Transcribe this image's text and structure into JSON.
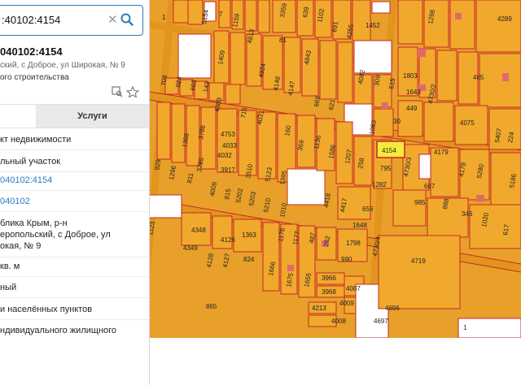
{
  "search": {
    "value": ":40102:4154"
  },
  "card": {
    "title": "040102:4154",
    "address": "ский, с Доброе, ул Широкая, № 9",
    "type": "ого строительства"
  },
  "tabs": {
    "services_label": "Услуги"
  },
  "details": [
    "кт недвижимости",
    "льный участок",
    "040102:4154",
    "040102",
    "блика Крым, р-н",
    "еропольский, с Доброе, ул",
    "окая, № 9",
    "кв. м",
    "ный",
    "и населённых пунктов",
    "ндивидуального жилищного"
  ],
  "map_labels": {
    "l1": "1",
    "l2": "5154",
    "l3": "7",
    "l4": "1159",
    "l5": "4813",
    "l6": "3359",
    "l7": "639",
    "l8": "1102",
    "l9": "691",
    "l10": "4255",
    "l11": "1452",
    "l12": "1298",
    "l13": "4289",
    "l14": "81",
    "l15": "4843",
    "l16": "4082",
    "l17": "309",
    "l18": "515",
    "l19": "1803",
    "l20": "1643",
    "l21": "465",
    "l22": "708",
    "l23": "924",
    "l24": "663",
    "l25": "143",
    "l26": "1409",
    "l27": "4803",
    "l28": "4924",
    "l29": "4148",
    "l30": "4147",
    "l31": "669",
    "l32": "621",
    "l33": "449",
    "l34": "4730/2",
    "l35": "4075",
    "l36": "715",
    "l37": "4031",
    "l38": "1308",
    "l39": "3786",
    "l40": "4753",
    "l41": "4033",
    "l42": "369",
    "l43": "1136",
    "l44": "160",
    "l45": "1083",
    "l46": "30",
    "l47": "4154",
    "l48": "4179",
    "l49": "5407",
    "l50": "224",
    "l51": "1296",
    "l52": "3785",
    "l53": "4032",
    "l54": "3917",
    "l55": "3510",
    "l56": "5123",
    "l57": "1385",
    "l58": "1586",
    "l59": "1207",
    "l60": "258",
    "l61": "795",
    "l62": "4730/3",
    "l63": "4178",
    "l64": "5280",
    "l65": "811",
    "l66": "929",
    "l67": "4009",
    "l68": "815",
    "l69": "5202",
    "l70": "5203",
    "l71": "1282",
    "l72": "667",
    "l73": "985",
    "l74": "888",
    "l75": "346",
    "l76": "5186",
    "l77": "1123",
    "l78": "5210",
    "l79": "1010",
    "l80": "4418",
    "l81": "4417",
    "l82": "656",
    "l83": "1020",
    "l84": "617",
    "l85": "4348",
    "l86": "4126",
    "l87": "1363",
    "l88": "1176",
    "l89": "1177",
    "l90": "1648",
    "l91": "4349",
    "l92": "4128",
    "l93": "4127",
    "l94": "824",
    "l95": "487",
    "l96": "262",
    "l97": "1798",
    "l98": "4730/4",
    "l99": "4719",
    "l100": "990",
    "l101": "1666",
    "l102": "1675",
    "l103": "1655",
    "l104": "3966",
    "l105": "3968",
    "l106": "4007",
    "l107": "4009",
    "l108": "4213",
    "l109": "4008",
    "l110": "865",
    "l111": "4696",
    "l112": "4697",
    "l113": "1"
  }
}
